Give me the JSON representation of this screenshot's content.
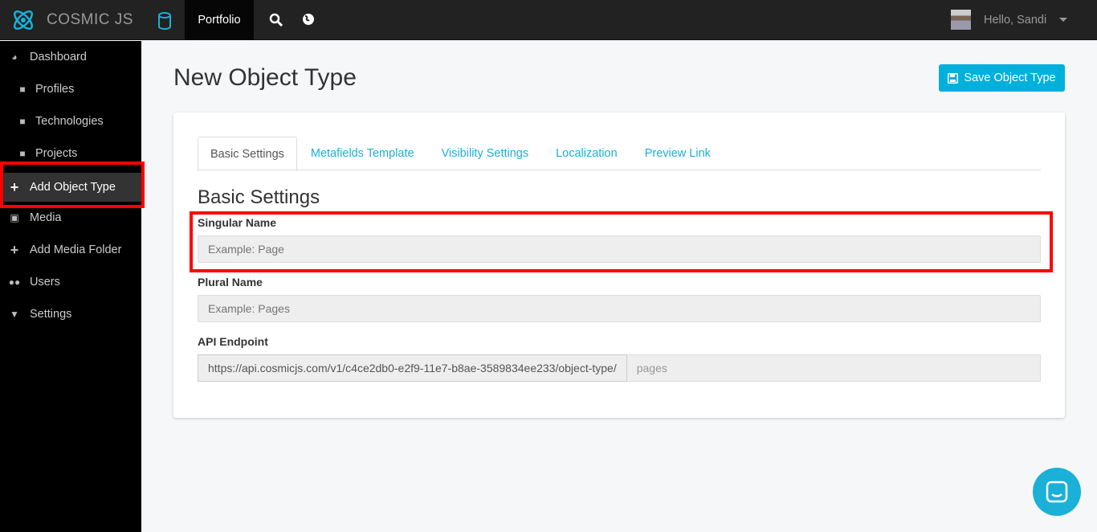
{
  "topbar": {
    "brand": "COSMIC JS",
    "bucket": "Portfolio",
    "user_greeting": "Hello, Sandi"
  },
  "sidebar": {
    "items": [
      {
        "label": "Dashboard",
        "icon": "dashboard-icon"
      },
      {
        "label": "Profiles",
        "icon": "folder-icon"
      },
      {
        "label": "Technologies",
        "icon": "folder-icon"
      },
      {
        "label": "Projects",
        "icon": "folder-icon"
      },
      {
        "label": "Add Object Type",
        "icon": "plus-icon",
        "active": true
      },
      {
        "label": "Media",
        "icon": "image-icon"
      },
      {
        "label": "Add Media Folder",
        "icon": "plus-icon"
      },
      {
        "label": "Users",
        "icon": "users-icon"
      },
      {
        "label": "Settings",
        "icon": "caret-down-icon"
      }
    ]
  },
  "main": {
    "title": "New Object Type",
    "save_label": "Save Object Type",
    "tabs": [
      {
        "label": "Basic Settings"
      },
      {
        "label": "Metafields Template"
      },
      {
        "label": "Visibility Settings"
      },
      {
        "label": "Localization"
      },
      {
        "label": "Preview Link"
      }
    ],
    "section_title": "Basic Settings",
    "singular": {
      "label": "Singular Name",
      "placeholder": "Example: Page"
    },
    "plural": {
      "label": "Plural Name",
      "placeholder": "Example: Pages"
    },
    "endpoint": {
      "label": "API Endpoint",
      "prefix": "https://api.cosmicjs.com/v1/c4ce2db0-e2f9-11e7-b8ae-3589834ee233/object-type/",
      "placeholder": "pages"
    }
  },
  "colors": {
    "accent": "#00b0dc",
    "highlight": "#ff0000"
  }
}
